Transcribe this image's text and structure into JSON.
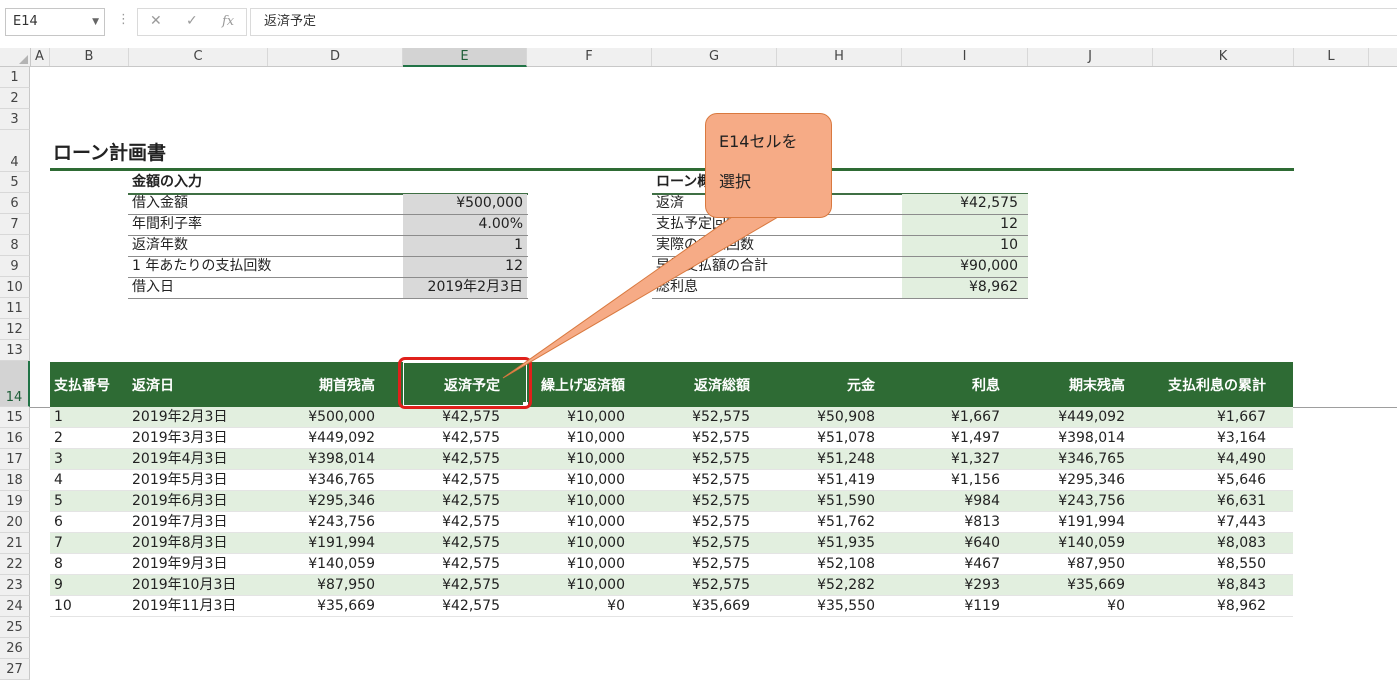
{
  "formula_bar": {
    "name_box": "E14",
    "cancel": "✕",
    "enter": "✓",
    "fx": "fx",
    "content": "返済予定"
  },
  "columns": [
    "A",
    "B",
    "C",
    "D",
    "E",
    "F",
    "G",
    "H",
    "I",
    "J",
    "K",
    "L"
  ],
  "selected_column": "E",
  "rows": [
    "1",
    "2",
    "3",
    "4",
    "5",
    "6",
    "7",
    "8",
    "9",
    "10",
    "11",
    "12",
    "13",
    "14",
    "15",
    "16",
    "17",
    "18",
    "19",
    "20",
    "21",
    "22",
    "23",
    "24",
    "25",
    "26",
    "27"
  ],
  "selected_row": "14",
  "sheet": {
    "title": "ローン計画書",
    "input_section": {
      "header": "金額の入力",
      "items": [
        {
          "label": "借入金額",
          "value": "¥500,000"
        },
        {
          "label": "年間利子率",
          "value": "4.00%"
        },
        {
          "label": "返済年数",
          "value": "1"
        },
        {
          "label": "1 年あたりの支払回数",
          "value": "12"
        },
        {
          "label": "借入日",
          "value": "2019年2月3日"
        }
      ]
    },
    "summary_section": {
      "header": "ローン概",
      "items": [
        {
          "label": "返済",
          "value": "¥42,575"
        },
        {
          "label": "支払予定回数",
          "value": "12"
        },
        {
          "label": "実際の支払回数",
          "value": "10"
        },
        {
          "label": "早期支払額の合計",
          "value": "¥90,000"
        },
        {
          "label": "総利息",
          "value": "¥8,962"
        }
      ]
    },
    "table": {
      "headers": [
        "支払番号",
        "返済日",
        "期首残高",
        "返済予定",
        "繰上げ返済額",
        "返済総額",
        "元金",
        "利息",
        "期末残高",
        "支払利息の累計"
      ],
      "rows": [
        [
          "1",
          "2019年2月3日",
          "¥500,000",
          "¥42,575",
          "¥10,000",
          "¥52,575",
          "¥50,908",
          "¥1,667",
          "¥449,092",
          "¥1,667"
        ],
        [
          "2",
          "2019年3月3日",
          "¥449,092",
          "¥42,575",
          "¥10,000",
          "¥52,575",
          "¥51,078",
          "¥1,497",
          "¥398,014",
          "¥3,164"
        ],
        [
          "3",
          "2019年4月3日",
          "¥398,014",
          "¥42,575",
          "¥10,000",
          "¥52,575",
          "¥51,248",
          "¥1,327",
          "¥346,765",
          "¥4,490"
        ],
        [
          "4",
          "2019年5月3日",
          "¥346,765",
          "¥42,575",
          "¥10,000",
          "¥52,575",
          "¥51,419",
          "¥1,156",
          "¥295,346",
          "¥5,646"
        ],
        [
          "5",
          "2019年6月3日",
          "¥295,346",
          "¥42,575",
          "¥10,000",
          "¥52,575",
          "¥51,590",
          "¥984",
          "¥243,756",
          "¥6,631"
        ],
        [
          "6",
          "2019年7月3日",
          "¥243,756",
          "¥42,575",
          "¥10,000",
          "¥52,575",
          "¥51,762",
          "¥813",
          "¥191,994",
          "¥7,443"
        ],
        [
          "7",
          "2019年8月3日",
          "¥191,994",
          "¥42,575",
          "¥10,000",
          "¥52,575",
          "¥51,935",
          "¥640",
          "¥140,059",
          "¥8,083"
        ],
        [
          "8",
          "2019年9月3日",
          "¥140,059",
          "¥42,575",
          "¥10,000",
          "¥52,575",
          "¥52,108",
          "¥467",
          "¥87,950",
          "¥8,550"
        ],
        [
          "9",
          "2019年10月3日",
          "¥87,950",
          "¥42,575",
          "¥10,000",
          "¥52,575",
          "¥52,282",
          "¥293",
          "¥35,669",
          "¥8,843"
        ],
        [
          "10",
          "2019年11月3日",
          "¥35,669",
          "¥42,575",
          "¥0",
          "¥35,669",
          "¥35,550",
          "¥119",
          "¥0",
          "¥8,962"
        ]
      ]
    }
  },
  "callout": {
    "line1": "E14セルを",
    "line2": "選択"
  },
  "colors": {
    "excel_green": "#217346",
    "header_green": "#2e6b34",
    "stripe_green": "#e2efdf",
    "input_gray": "#d9d9d9",
    "callout_fill": "#f6ab86",
    "highlight_red": "#e0201b"
  }
}
